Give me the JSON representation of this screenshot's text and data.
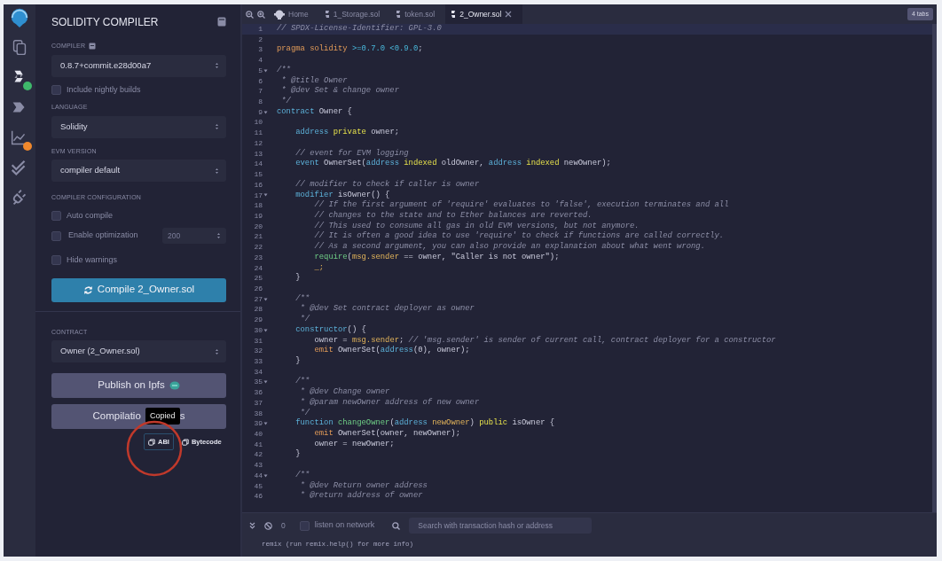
{
  "icon_bar": [
    {
      "kind": "files",
      "selected": false
    },
    {
      "kind": "compiler",
      "selected": true,
      "color": "#3fb96b"
    },
    {
      "kind": "deploy",
      "selected": false
    },
    {
      "kind": "analysis",
      "selected": false,
      "color": "#f0882c"
    },
    {
      "kind": "verify",
      "selected": false
    },
    {
      "kind": "plugin",
      "selected": false
    }
  ],
  "side_panel": {
    "title": "SOLIDITY COMPILER",
    "compiler": {
      "label": "COMPILER",
      "value": "0.8.7+commit.e28d00a7"
    },
    "nightly": {
      "label": "Include nightly builds",
      "checked": false
    },
    "language": {
      "label": "LANGUAGE",
      "value": "Solidity"
    },
    "evm": {
      "label": "EVM VERSION",
      "value": "compiler default"
    },
    "config": {
      "label": "COMPILER CONFIGURATION",
      "options": [
        {
          "label": "Auto compile",
          "checked": false
        },
        {
          "label": "Enable optimization",
          "checked": false,
          "runs": {
            "value": "200",
            "disabled": true
          }
        },
        {
          "label": "Hide warnings",
          "checked": false
        }
      ]
    },
    "compile_button": "Compile 2_Owner.sol",
    "contract": {
      "label": "CONTRACT",
      "value": "Owner (2_Owner.sol)"
    },
    "publish_button": "Publish on Ipfs",
    "details_button": {
      "visible_parts": [
        "Compilatio",
        "s"
      ]
    },
    "tooltip": "Copied",
    "copy_links": [
      {
        "label": "ABI",
        "focused": true
      },
      {
        "label": "Bytecode",
        "focused": false
      }
    ],
    "annotation": {
      "kind": "circle",
      "color": "#c0392b"
    }
  },
  "tabs": [
    {
      "kind": "home",
      "label": "Home",
      "selected": false
    },
    {
      "kind": "file",
      "label": "1_Storage.sol",
      "selected": false
    },
    {
      "kind": "file",
      "label": "token.sol",
      "selected": false
    },
    {
      "kind": "file",
      "label": "2_Owner.sol",
      "selected": true
    }
  ],
  "tab_count": "4 tabs",
  "code": [
    {
      "n": "1",
      "active": true,
      "fold": false,
      "tokens": [
        {
          "t": "// SPDX-License-Identifier: GPL-3.0",
          "kind": "comment"
        }
      ]
    },
    {
      "n": "2",
      "active": false,
      "fold": false
    },
    {
      "n": "3",
      "active": false,
      "fold": false,
      "tokens": [
        {
          "t": "pragma solidity",
          "kind": "pragma"
        },
        {
          "t": " >=0.7.0 <0.9.0",
          "kind": "number"
        },
        {
          "t": ";",
          "kind": "plain"
        }
      ]
    },
    {
      "n": "4",
      "active": false,
      "fold": false
    },
    {
      "n": "5",
      "active": false,
      "fold": true,
      "tokens": [
        {
          "t": "/**",
          "kind": "comment"
        }
      ]
    },
    {
      "n": "6",
      "active": false,
      "fold": false,
      "tokens": [
        {
          "t": " * @title Owner",
          "kind": "comment"
        }
      ]
    },
    {
      "n": "7",
      "active": false,
      "fold": false,
      "tokens": [
        {
          "t": " * @dev Set & change owner",
          "kind": "comment"
        }
      ]
    },
    {
      "n": "8",
      "active": false,
      "fold": false,
      "tokens": [
        {
          "t": " */",
          "kind": "comment"
        }
      ]
    },
    {
      "n": "9",
      "active": false,
      "fold": true,
      "tokens": [
        {
          "t": "contract",
          "kind": "keyword"
        },
        {
          "t": " Owner {",
          "kind": "plain"
        }
      ]
    },
    {
      "n": "10",
      "active": false,
      "fold": false
    },
    {
      "n": "11",
      "active": false,
      "fold": false,
      "tokens": [
        {
          "t": "    address",
          "kind": "keyword"
        },
        {
          "t": " private",
          "kind": "storage"
        },
        {
          "t": " owner;",
          "kind": "plain"
        }
      ]
    },
    {
      "n": "12",
      "active": false,
      "fold": false
    },
    {
      "n": "13",
      "active": false,
      "fold": false,
      "tokens": [
        {
          "t": "    // event for EVM logging",
          "kind": "comment"
        }
      ]
    },
    {
      "n": "14",
      "active": false,
      "fold": false,
      "tokens": [
        {
          "t": "    event",
          "kind": "keyword"
        },
        {
          "t": " OwnerSet(",
          "kind": "plain"
        },
        {
          "t": "address",
          "kind": "keyword"
        },
        {
          "t": " indexed",
          "kind": "storage"
        },
        {
          "t": " oldOwner, ",
          "kind": "plain"
        },
        {
          "t": "address",
          "kind": "keyword"
        },
        {
          "t": " indexed",
          "kind": "storage"
        },
        {
          "t": " newOwner);",
          "kind": "plain"
        }
      ]
    },
    {
      "n": "15",
      "active": false,
      "fold": false
    },
    {
      "n": "16",
      "active": false,
      "fold": false,
      "tokens": [
        {
          "t": "    // modifier to check if caller is owner",
          "kind": "comment"
        }
      ]
    },
    {
      "n": "17",
      "active": false,
      "fold": true,
      "tokens": [
        {
          "t": "    modifier",
          "kind": "keyword"
        },
        {
          "t": " isOwner() {",
          "kind": "plain"
        }
      ]
    },
    {
      "n": "18",
      "active": false,
      "fold": false,
      "tokens": [
        {
          "t": "        // If the first argument of 'require' evaluates to 'false', execution terminates and all",
          "kind": "comment"
        }
      ]
    },
    {
      "n": "19",
      "active": false,
      "fold": false,
      "tokens": [
        {
          "t": "        // changes to the state and to Ether balances are reverted.",
          "kind": "comment"
        }
      ]
    },
    {
      "n": "20",
      "active": false,
      "fold": false,
      "tokens": [
        {
          "t": "        // This used to consume all gas in old EVM versions, but not anymore.",
          "kind": "comment"
        }
      ]
    },
    {
      "n": "21",
      "active": false,
      "fold": false,
      "tokens": [
        {
          "t": "        // It is often a good idea to use 'require' to check if functions are called correctly.",
          "kind": "comment"
        }
      ]
    },
    {
      "n": "22",
      "active": false,
      "fold": false,
      "tokens": [
        {
          "t": "        // As a second argument, you can also provide an explanation about what went wrong.",
          "kind": "comment"
        }
      ]
    },
    {
      "n": "23",
      "active": false,
      "fold": false,
      "tokens": [
        {
          "t": "        require",
          "kind": "builtin"
        },
        {
          "t": "(",
          "kind": "plain"
        },
        {
          "t": "msg.sender",
          "kind": "global"
        },
        {
          "t": " == owner, \"Caller is not owner\");",
          "kind": "plain"
        }
      ]
    },
    {
      "n": "24",
      "active": false,
      "fold": false,
      "tokens": [
        {
          "t": "        _;",
          "kind": "global"
        }
      ]
    },
    {
      "n": "25",
      "active": false,
      "fold": false,
      "tokens": [
        {
          "t": "    }",
          "kind": "plain"
        }
      ]
    },
    {
      "n": "26",
      "active": false,
      "fold": false
    },
    {
      "n": "27",
      "active": false,
      "fold": true,
      "tokens": [
        {
          "t": "    /**",
          "kind": "comment"
        }
      ]
    },
    {
      "n": "28",
      "active": false,
      "fold": false,
      "tokens": [
        {
          "t": "     * @dev Set contract deployer as owner",
          "kind": "comment"
        }
      ]
    },
    {
      "n": "29",
      "active": false,
      "fold": false,
      "tokens": [
        {
          "t": "     */",
          "kind": "comment"
        }
      ]
    },
    {
      "n": "30",
      "active": false,
      "fold": true,
      "tokens": [
        {
          "t": "    constructor",
          "kind": "keyword"
        },
        {
          "t": "() {",
          "kind": "plain"
        }
      ]
    },
    {
      "n": "31",
      "active": false,
      "fold": false,
      "tokens": [
        {
          "t": "        owner = ",
          "kind": "plain"
        },
        {
          "t": "msg.sender",
          "kind": "global"
        },
        {
          "t": ";",
          "kind": "plain"
        },
        {
          "t": " // 'msg.sender' is sender of current call, contract deployer for a constructor",
          "kind": "comment"
        }
      ]
    },
    {
      "n": "32",
      "active": false,
      "fold": false,
      "tokens": [
        {
          "t": "        emit",
          "kind": "pragma"
        },
        {
          "t": " OwnerSet(",
          "kind": "plain"
        },
        {
          "t": "address",
          "kind": "keyword"
        },
        {
          "t": "(0), owner);",
          "kind": "plain"
        }
      ]
    },
    {
      "n": "33",
      "active": false,
      "fold": false,
      "tokens": [
        {
          "t": "    }",
          "kind": "plain"
        }
      ]
    },
    {
      "n": "34",
      "active": false,
      "fold": false
    },
    {
      "n": "35",
      "active": false,
      "fold": true,
      "tokens": [
        {
          "t": "    /**",
          "kind": "comment"
        }
      ]
    },
    {
      "n": "36",
      "active": false,
      "fold": false,
      "tokens": [
        {
          "t": "     * @dev Change owner",
          "kind": "comment"
        }
      ]
    },
    {
      "n": "37",
      "active": false,
      "fold": false,
      "tokens": [
        {
          "t": "     * @param newOwner address of new owner",
          "kind": "comment"
        }
      ]
    },
    {
      "n": "38",
      "active": false,
      "fold": false,
      "tokens": [
        {
          "t": "     */",
          "kind": "comment"
        }
      ]
    },
    {
      "n": "39",
      "active": false,
      "fold": true,
      "tokens": [
        {
          "t": "    function",
          "kind": "keyword"
        },
        {
          "t": " changeOwner",
          "kind": "builtin"
        },
        {
          "t": "(",
          "kind": "plain"
        },
        {
          "t": "address",
          "kind": "keyword"
        },
        {
          "t": " newOwner",
          "kind": "global"
        },
        {
          "t": ")",
          "kind": "plain"
        },
        {
          "t": " public",
          "kind": "storage"
        },
        {
          "t": " isOwner {",
          "kind": "plain"
        }
      ]
    },
    {
      "n": "40",
      "active": false,
      "fold": false,
      "tokens": [
        {
          "t": "        emit",
          "kind": "pragma"
        },
        {
          "t": " OwnerSet(owner, newOwner);",
          "kind": "plain"
        }
      ]
    },
    {
      "n": "41",
      "active": false,
      "fold": false,
      "tokens": [
        {
          "t": "        owner = newOwner;",
          "kind": "plain"
        }
      ]
    },
    {
      "n": "42",
      "active": false,
      "fold": false,
      "tokens": [
        {
          "t": "    }",
          "kind": "plain"
        }
      ]
    },
    {
      "n": "43",
      "active": false,
      "fold": false
    },
    {
      "n": "44",
      "active": false,
      "fold": true,
      "tokens": [
        {
          "t": "    /**",
          "kind": "comment"
        }
      ]
    },
    {
      "n": "45",
      "active": false,
      "fold": false,
      "tokens": [
        {
          "t": "     * @dev Return owner address",
          "kind": "comment"
        }
      ]
    },
    {
      "n": "46",
      "active": false,
      "fold": false,
      "tokens": [
        {
          "t": "     * @return address of owner",
          "kind": "comment"
        }
      ]
    }
  ],
  "terminal": {
    "pending_count": "0",
    "listen": {
      "label": "listen on network",
      "checked": false
    },
    "search": {
      "placeholder": "Search with transaction hash or address"
    },
    "log": "remix (run remix.help() for more info)"
  }
}
